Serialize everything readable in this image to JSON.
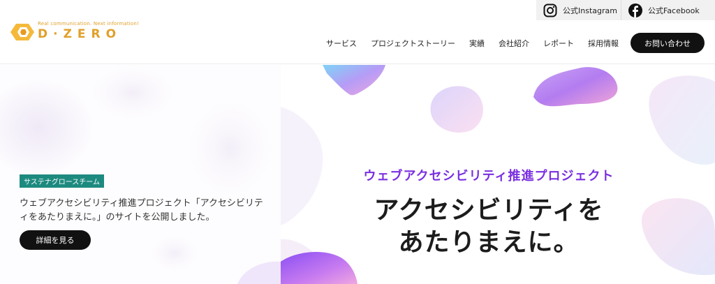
{
  "header": {
    "logo": {
      "tagline": "Real communication. Next information!",
      "brand": "D·ZERO"
    },
    "social": {
      "instagram_label": "公式Instagram",
      "facebook_label": "公式Facebook"
    },
    "nav": [
      {
        "label": "サービス"
      },
      {
        "label": "プロジェクトストーリー"
      },
      {
        "label": "実績"
      },
      {
        "label": "会社紹介"
      },
      {
        "label": "レポート"
      },
      {
        "label": "採用情報"
      }
    ],
    "contact_label": "お問い合わせ"
  },
  "news": {
    "badge": "サステナグロースチーム",
    "text": "ウェブアクセシビリティ推進プロジェクト「アクセシビリティをあたりまえに。」のサイトを公開しました。",
    "button_label": "詳細を見る"
  },
  "hero": {
    "project_title": "ウェブアクセシビリティ推進プロジェクト",
    "headline_line1": "アクセシビリティを",
    "headline_line2": "あたりまえに。"
  },
  "colors": {
    "brand_orange": "#e0a02a",
    "badge_teal": "#1d8a7f",
    "accent_purple": "#7a2fe0",
    "button_black": "#111111"
  },
  "icons": [
    "hexagon-logo-icon",
    "instagram-icon",
    "facebook-icon"
  ]
}
